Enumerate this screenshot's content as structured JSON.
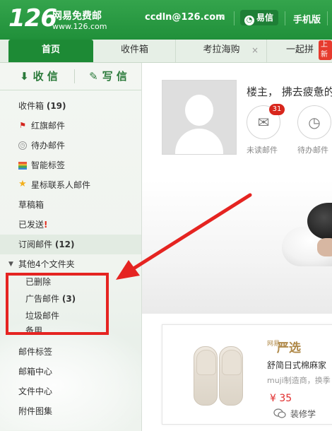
{
  "header": {
    "logo_number": "126",
    "logo_name": "网易免费邮",
    "logo_url": "www.126.com",
    "user_email": "ccdln@126.com",
    "yixin_label": "易信",
    "mobile_label": "手机版",
    "brand_color": "#25973f"
  },
  "tabs": {
    "home": "首页",
    "inbox": "收件箱",
    "kaola": "考拉海购",
    "kaola_close": "×",
    "pin": "一起拼",
    "pin_badge": "上新"
  },
  "sidebar": {
    "receive_label": "收 信",
    "compose_label": "写 信",
    "inbox_label": "收件箱",
    "inbox_count": "(19)",
    "flagged_label": "红旗邮件",
    "todo_label": "待办邮件",
    "smart_tags_label": "智能标签",
    "starred_contacts_label": "星标联系人邮件",
    "drafts_label": "草稿箱",
    "sent_label": "已发送",
    "sent_mark": "!",
    "subscriptions_label": "订阅邮件",
    "subscriptions_count": "(12)",
    "other_folders_label": "其他4个文件夹",
    "deleted_label": "已删除",
    "ads_label": "广告邮件",
    "ads_count": "(3)",
    "spam_label": "垃圾邮件",
    "backup_label": "备用",
    "mail_tags_label": "邮件标签",
    "mail_center_label": "邮箱中心",
    "file_center_label": "文件中心",
    "attachments_label": "附件图集"
  },
  "main": {
    "greeting": "楼主， 拂去疲惫的",
    "unread_badge": "31",
    "unread_label": "未读邮件",
    "todo_label": "待办邮件",
    "product_brand_small": "网易",
    "product_brand": "严选",
    "product_title": "舒简日式棉麻家",
    "product_sub": "muji制造商，换季",
    "product_price": "¥ 35",
    "watermark": "装修学"
  },
  "annotation": {
    "color": "#e52421"
  }
}
